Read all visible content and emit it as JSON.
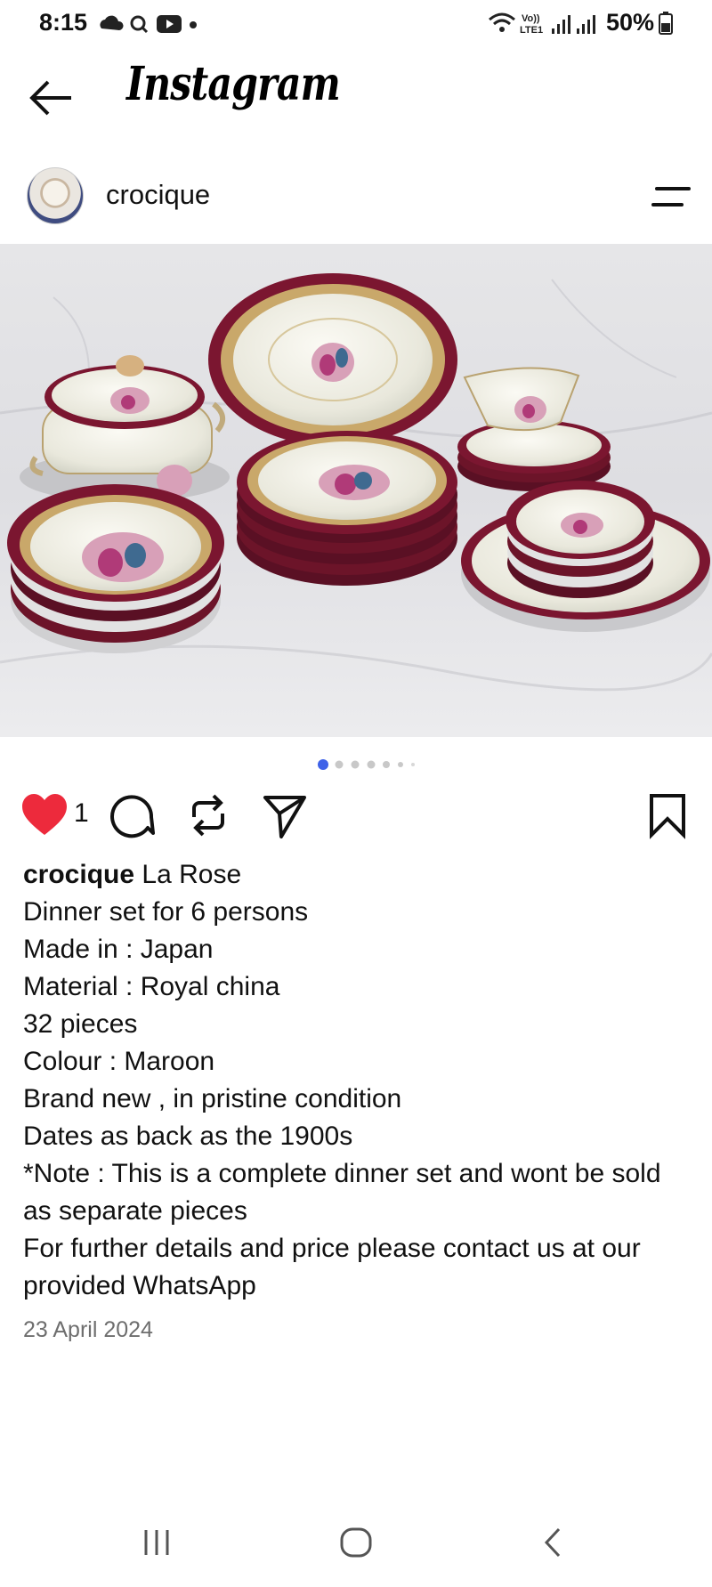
{
  "status_bar": {
    "time": "8:15",
    "network_label": "Vo)) LTE1",
    "battery": "50%"
  },
  "header": {
    "app_name": "Instagram",
    "back_icon": "back-arrow-icon"
  },
  "post": {
    "username": "crocique",
    "image_description_icon": "photo-dinner-set",
    "carousel": {
      "count": 6,
      "active_index": 0
    },
    "likes": "1",
    "caption_first": "La Rose",
    "caption_lines": [
      "Dinner set for 6 persons",
      "Made in : Japan",
      "Material : Royal china",
      "32 pieces",
      "Colour : Maroon",
      "Brand new , in pristine condition",
      "Dates as back as the 1900s",
      "*Note : This is a complete dinner set and wont be sold as separate pieces",
      "For further details and price please contact us at our provided WhatsApp"
    ],
    "date": "23 April 2024"
  },
  "colors": {
    "like_red": "#ed2a3c",
    "carousel_active": "#3f62e8",
    "carousel_inactive": "#c8c8c8",
    "date_gray": "#6e6e6e"
  }
}
